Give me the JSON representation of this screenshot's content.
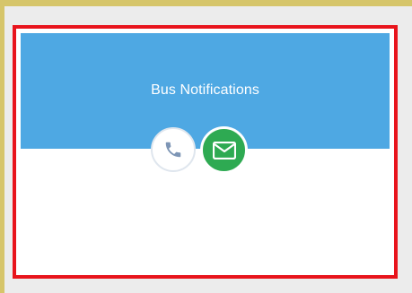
{
  "card": {
    "title": "Bus Notifications"
  },
  "actions": [
    {
      "icon": "phone-icon",
      "color": "#7d95b5",
      "background": "#ffffff"
    },
    {
      "icon": "envelope-icon",
      "color": "#ffffff",
      "background": "#2eaa52"
    }
  ],
  "colors": {
    "header": "#4ea8e3",
    "highlight_border": "#e8141c",
    "frame": "#d6c56a"
  }
}
